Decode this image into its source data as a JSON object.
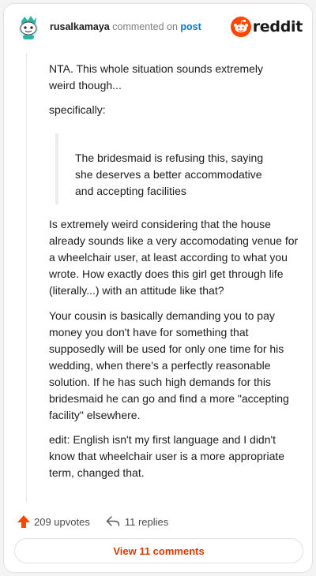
{
  "header": {
    "username": "rusalkamaya",
    "action_text": " commented on ",
    "post_link": "post",
    "logo_text": "reddit",
    "avatar_icon": "snoo-avatar-icon",
    "logo_icon": "reddit-snoo-icon"
  },
  "comment": {
    "p1": "NTA. This whole situation sounds extremely weird though...",
    "p2": "specifically:",
    "quote": "The bridesmaid is refusing this, saying she deserves a better accommodative and accepting facilities",
    "p3": "Is extremely weird considering that the house already sounds like a very accomodating venue for a wheelchair user, at least according to what you wrote. How exactly does this girl get through life (literally...) with an attitude like that?",
    "p4": "Your cousin is basically demanding you to pay money you don't have for something that supposedly will be used for only one time for his wedding, when there's a perfectly reasonable solution. If he has such high demands for this bridesmaid he can go and find a more \"accepting facility\" elsewhere.",
    "p5": "edit: English isn't my first language and I didn't know that wheelchair user is a more appropriate term, changed that."
  },
  "footer": {
    "upvotes": "209 upvotes",
    "replies": "11 replies",
    "view_comments": "View 11 comments",
    "upvote_icon": "upvote-arrow-icon",
    "reply_icon": "reply-arrow-icon"
  },
  "colors": {
    "accent": "#ff4500",
    "link": "#0079d3",
    "view_button_text": "#d93a00"
  }
}
